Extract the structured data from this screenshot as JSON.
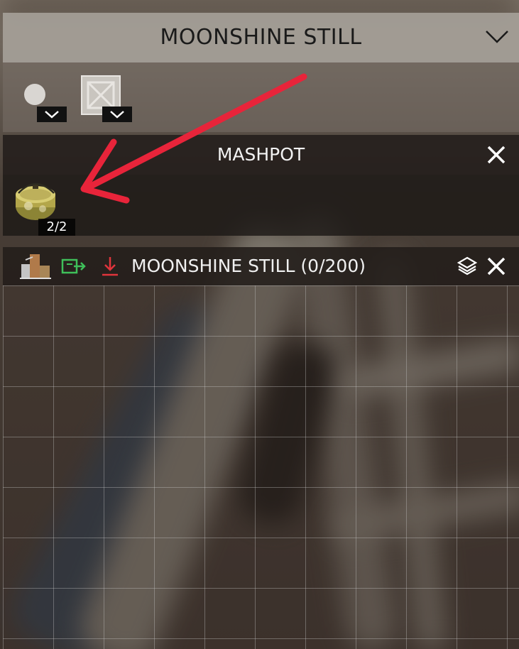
{
  "header": {
    "title": "MOONSHINE STILL",
    "chevron_icon": "chevron-down-icon"
  },
  "indicators": [
    {
      "icon": "circle-icon",
      "expand_icon": "chevron-down-icon"
    },
    {
      "icon": "crossed-box-icon",
      "expand_icon": "chevron-down-icon"
    }
  ],
  "mashpot": {
    "title": "MASHPOT",
    "close_icon": "close-icon",
    "item": {
      "icon": "mashpot-item-icon",
      "count": "2/2"
    }
  },
  "still": {
    "title": "MOONSHINE STILL (0/200)",
    "icons": {
      "still": "moonshine-still-icon",
      "move": "transfer-icon",
      "download": "download-arrow-icon",
      "layers": "layers-icon",
      "close": "close-icon"
    },
    "colors": {
      "move": "#3fc05a",
      "download": "#e0343c"
    }
  },
  "annotation": {
    "arrow_color": "#e8243a"
  }
}
